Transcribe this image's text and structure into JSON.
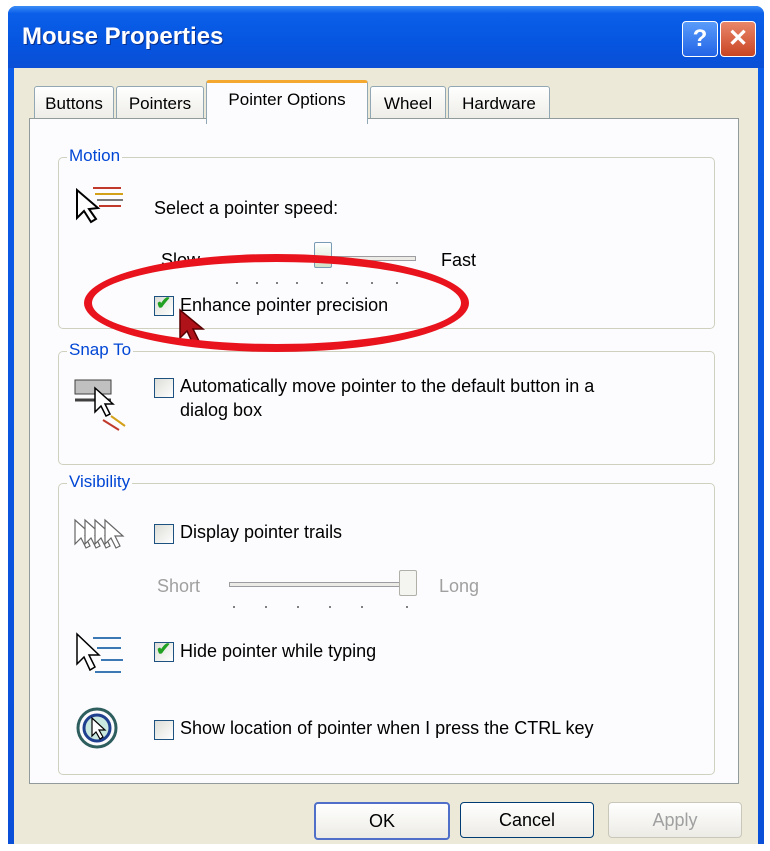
{
  "window": {
    "title": "Mouse Properties",
    "help_icon": "help-icon",
    "close_icon": "close-icon"
  },
  "tabs": [
    {
      "label": "Buttons"
    },
    {
      "label": "Pointers"
    },
    {
      "label": "Pointer Options",
      "active": true
    },
    {
      "label": "Wheel"
    },
    {
      "label": "Hardware"
    }
  ],
  "motion": {
    "group_label": "Motion",
    "speed_prompt": "Select a pointer speed:",
    "slow_label": "Slow",
    "fast_label": "Fast",
    "enhance_label": "Enhance pointer precision",
    "enhance_checked": true
  },
  "snapto": {
    "group_label": "Snap To",
    "auto_label_line1": "Automatically move pointer to the default button in a",
    "auto_label_line2": "dialog box",
    "auto_checked": false
  },
  "visibility": {
    "group_label": "Visibility",
    "trails_label": "Display pointer trails",
    "trails_checked": false,
    "short_label": "Short",
    "long_label": "Long",
    "hide_label": "Hide pointer while typing",
    "hide_checked": true,
    "ctrl_label": "Show location of pointer when I press the CTRL key",
    "ctrl_checked": false
  },
  "buttons": {
    "ok": "OK",
    "cancel": "Cancel",
    "apply": "Apply"
  },
  "colors": {
    "title_blue": "#0a5ce8",
    "group_label": "#0046d5",
    "annotation_red": "#e8131c"
  }
}
